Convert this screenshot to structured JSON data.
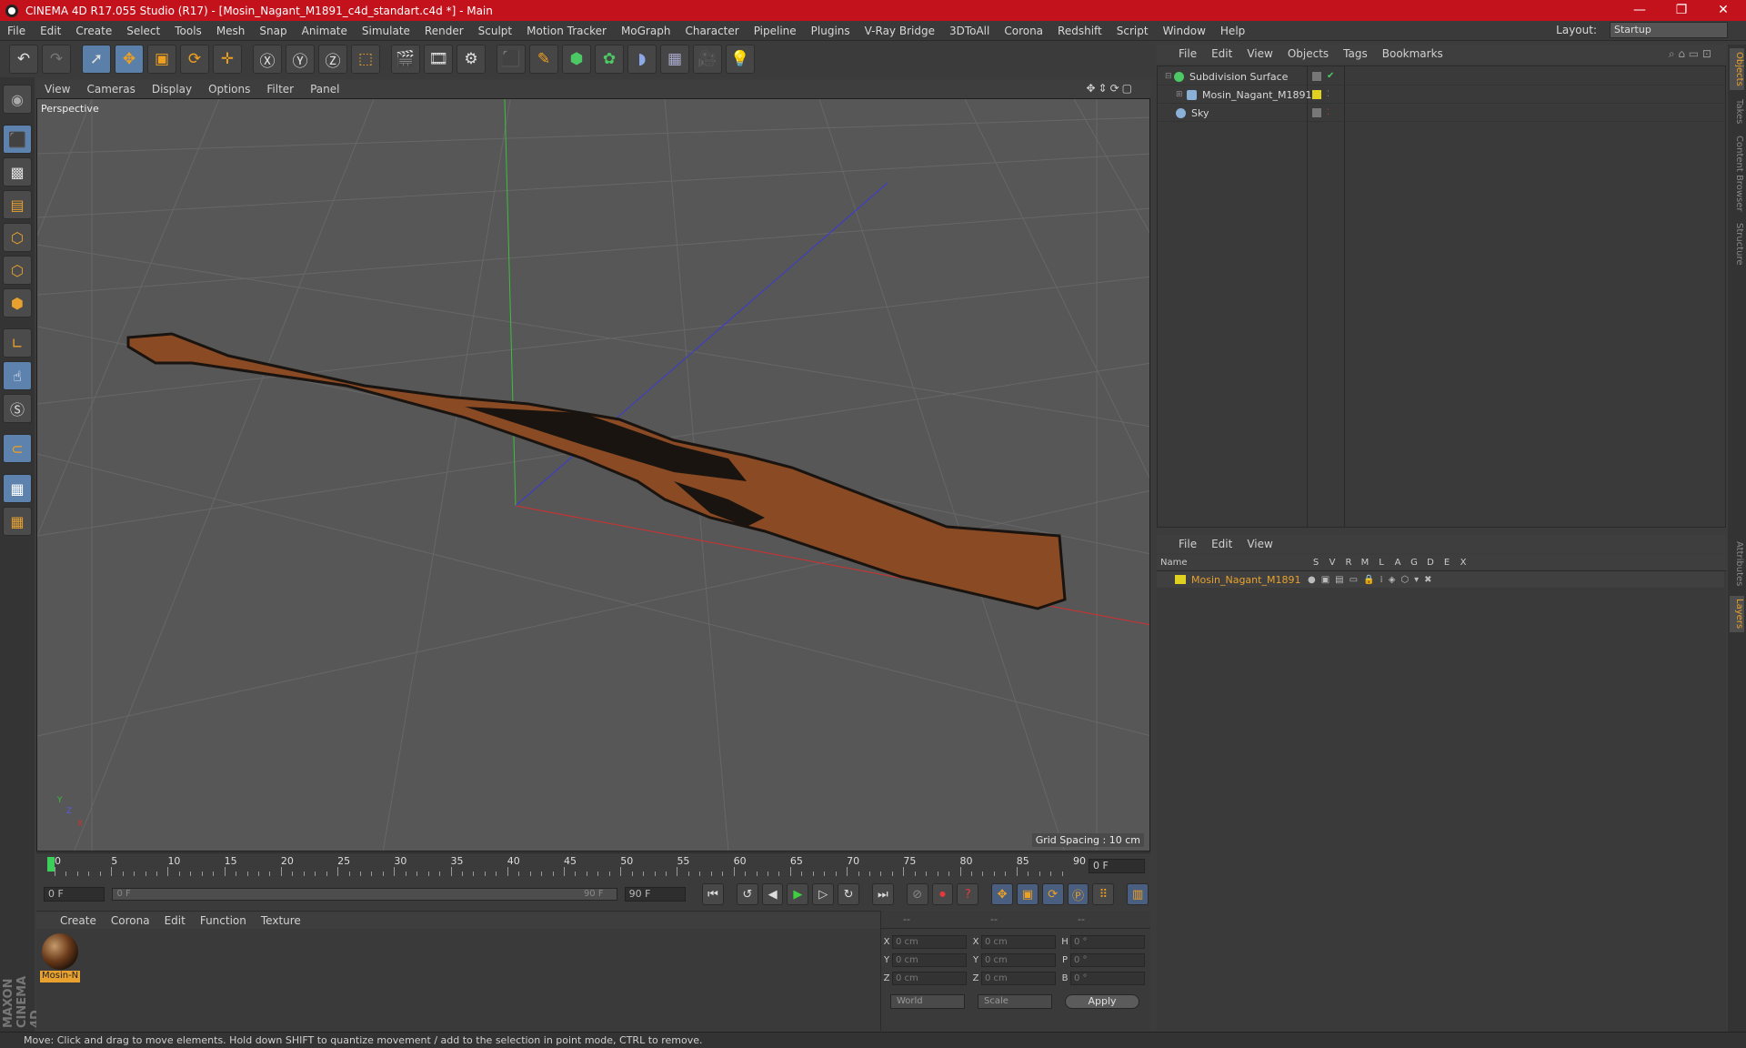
{
  "window": {
    "title": "CINEMA 4D R17.055 Studio (R17) - [Mosin_Nagant_M1891_c4d_standart.c4d *] - Main",
    "minimize": "—",
    "restore": "❐",
    "close": "✕"
  },
  "menu": [
    "File",
    "Edit",
    "Create",
    "Select",
    "Tools",
    "Mesh",
    "Snap",
    "Animate",
    "Simulate",
    "Render",
    "Sculpt",
    "Motion Tracker",
    "MoGraph",
    "Character",
    "Pipeline",
    "Plugins",
    "V-Ray Bridge",
    "3DToAll",
    "Corona",
    "Redshift",
    "Script",
    "Window",
    "Help"
  ],
  "layout": {
    "label": "Layout:",
    "value": "Startup"
  },
  "viewport": {
    "menu": [
      "View",
      "Cameras",
      "Display",
      "Options",
      "Filter",
      "Panel"
    ],
    "camera": "Perspective",
    "grid_spacing": "Grid Spacing : 10 cm",
    "axis_y": "Y",
    "axis_z": "Z",
    "axis_x": "X"
  },
  "timeline": {
    "ticks": [
      "0",
      "5",
      "10",
      "15",
      "20",
      "25",
      "30",
      "35",
      "40",
      "45",
      "50",
      "55",
      "60",
      "65",
      "70",
      "75",
      "80",
      "85",
      "90"
    ],
    "end_field": "0 F",
    "start_field": "0 F",
    "slider_start": "0 F",
    "slider_end": "90 F",
    "max_field": "90 F"
  },
  "materials": {
    "menu": [
      "Create",
      "Corona",
      "Edit",
      "Function",
      "Texture"
    ],
    "item": "Mosin-N"
  },
  "coords": {
    "head": [
      "--",
      "--",
      "--"
    ],
    "rows": [
      {
        "a": "X",
        "av": "0 cm",
        "b": "X",
        "bv": "0 cm",
        "c": "H",
        "cv": "0 °"
      },
      {
        "a": "Y",
        "av": "0 cm",
        "b": "Y",
        "bv": "0 cm",
        "c": "P",
        "cv": "0 °"
      },
      {
        "a": "Z",
        "av": "0 cm",
        "b": "Z",
        "bv": "0 cm",
        "c": "B",
        "cv": "0 °"
      }
    ],
    "mode1": "World",
    "mode2": "Scale",
    "apply": "Apply"
  },
  "objects": {
    "menu": [
      "File",
      "Edit",
      "View",
      "Objects",
      "Tags",
      "Bookmarks"
    ],
    "items": [
      {
        "name": "Subdivision Surface"
      },
      {
        "name": "Mosin_Nagant_M1891"
      },
      {
        "name": "Sky"
      }
    ]
  },
  "layers": {
    "menu": [
      "File",
      "Edit",
      "View"
    ],
    "headers": [
      "Name",
      "S",
      "V",
      "R",
      "M",
      "L",
      "A",
      "G",
      "D",
      "E",
      "X"
    ],
    "item": "Mosin_Nagant_M1891"
  },
  "sidetabs": [
    "Objects",
    "Takes",
    "Content Browser",
    "Structure",
    "Attributes",
    "Layers"
  ],
  "status": "Move: Click and drag to move elements. Hold down SHIFT to quantize movement / add to the selection in point mode, CTRL to remove.",
  "brand": "MAXON CINEMA 4D"
}
